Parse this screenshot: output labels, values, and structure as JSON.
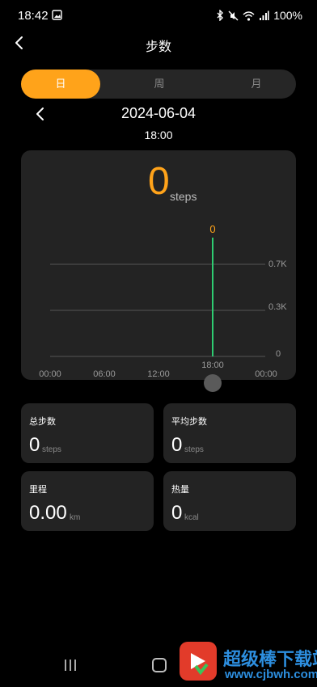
{
  "status_bar": {
    "time": "18:42",
    "battery": "100%"
  },
  "header": {
    "title": "步数"
  },
  "tabs": [
    {
      "label": "日",
      "active": true
    },
    {
      "label": "周",
      "active": false
    },
    {
      "label": "月",
      "active": false
    }
  ],
  "date": {
    "value": "2024-06-04",
    "time": "18:00"
  },
  "summary": {
    "steps": "0",
    "unit": "steps"
  },
  "chart_data": {
    "type": "bar",
    "selected_value_label": "0",
    "y_ticks": [
      "0.7K",
      "0.3K",
      "0"
    ],
    "x_ticks": [
      "00:00",
      "06:00",
      "12:00",
      "18:00",
      "00:00"
    ],
    "marker_label": "18:00",
    "series": [
      {
        "values": [
          0
        ]
      }
    ]
  },
  "stats": [
    {
      "label": "总步数",
      "value": "0",
      "unit": "steps"
    },
    {
      "label": "平均步数",
      "value": "0",
      "unit": "steps"
    },
    {
      "label": "里程",
      "value": "0.00",
      "unit": "km"
    },
    {
      "label": "热量",
      "value": "0",
      "unit": "kcal"
    }
  ],
  "watermark": {
    "title": "超级棒下载站",
    "url": "www.cjbwh.com"
  },
  "colors": {
    "accent": "#ffa31a",
    "card": "#232323",
    "marker": "#2ecc71"
  },
  "icons": [
    "back-chevron-icon",
    "image-icon",
    "bluetooth-icon",
    "mute-icon",
    "wifi-icon",
    "signal-icon",
    "date-prev-icon",
    "recent-apps-icon",
    "home-icon",
    "watermark-logo-icon"
  ]
}
